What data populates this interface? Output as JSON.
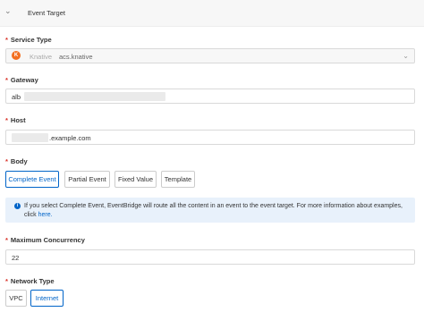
{
  "header": {
    "title": "Event Target",
    "collapse_icon": "chevron-down-icon"
  },
  "service_type": {
    "label": "Service Type",
    "required_mark": "*",
    "icon": "knative-icon",
    "service_name": "Knative",
    "value": "acs.knative"
  },
  "gateway": {
    "label": "Gateway",
    "required_mark": "*",
    "value_prefix": "alb"
  },
  "host": {
    "label": "Host",
    "required_mark": "*",
    "value_suffix": ".example.com"
  },
  "body": {
    "label": "Body",
    "required_mark": "*",
    "options": [
      "Complete Event",
      "Partial Event",
      "Fixed Value",
      "Template"
    ],
    "selected": "Complete Event",
    "info_text": "If you select Complete Event, EventBridge will route all the content in an event to the event target. For more information about examples, click",
    "info_link": "here."
  },
  "max_concurrency": {
    "label": "Maximum Concurrency",
    "required_mark": "*",
    "value": "22"
  },
  "network_type": {
    "label": "Network Type",
    "required_mark": "*",
    "options": [
      "VPC",
      "Internet"
    ],
    "selected": "Internet"
  },
  "colors": {
    "accent": "#0064c8",
    "required": "#d93026",
    "info_bg": "#e8f1fb"
  }
}
